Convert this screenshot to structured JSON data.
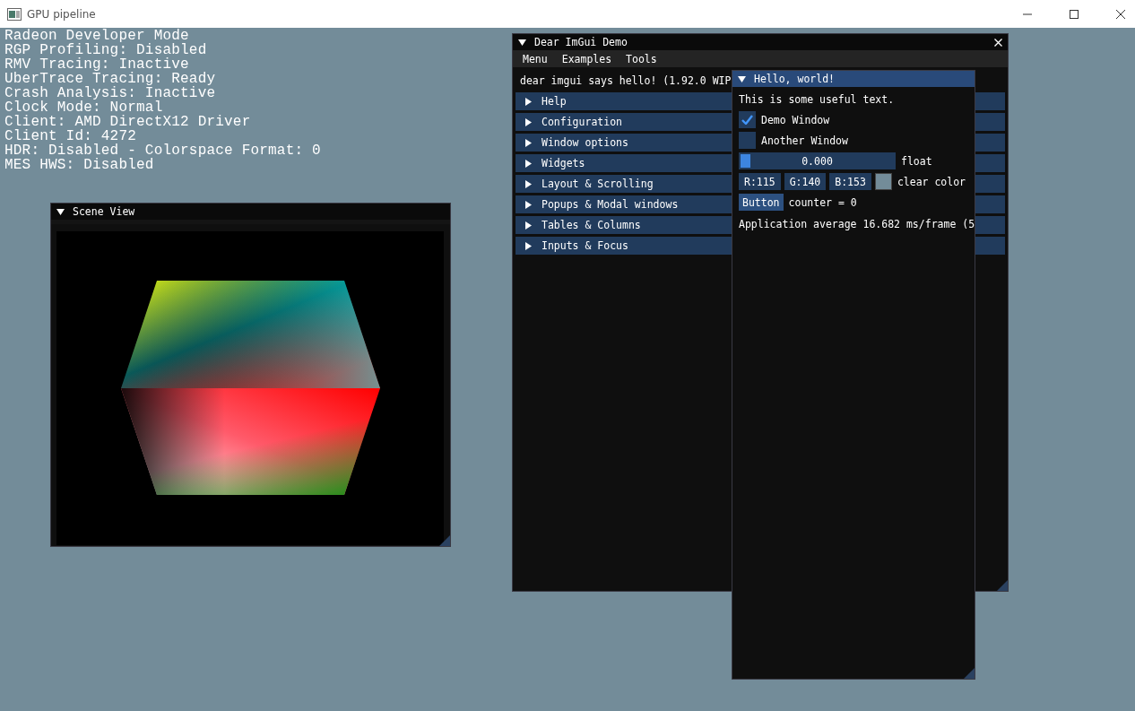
{
  "window": {
    "title": "GPU pipeline"
  },
  "overlay_lines": [
    "Radeon Developer Mode",
    "RGP Profiling: Disabled",
    "RMV Tracing: Inactive",
    "UberTrace Tracing: Ready",
    "Crash Analysis: Inactive",
    "Clock Mode: Normal",
    "Client: AMD DirectX12 Driver",
    "Client Id: 4272",
    "HDR: Disabled - Colorspace Format: 0",
    "MES HWS: Disabled"
  ],
  "scene_view": {
    "title": "Scene View"
  },
  "demo_window": {
    "title": "Dear ImGui Demo",
    "menu": [
      "Menu",
      "Examples",
      "Tools"
    ],
    "greeting": "dear imgui says hello! (1.92.0 WIP",
    "headers": [
      {
        "label": "Help",
        "expanded": false
      },
      {
        "label": "Configuration",
        "expanded": false
      },
      {
        "label": "Window options",
        "expanded": false
      },
      {
        "label": "Widgets",
        "expanded": false
      },
      {
        "label": "Layout & Scrolling",
        "expanded": false
      },
      {
        "label": "Popups & Modal windows",
        "expanded": false
      },
      {
        "label": "Tables & Columns",
        "expanded": false
      },
      {
        "label": "Inputs & Focus",
        "expanded": false
      }
    ]
  },
  "hello_window": {
    "title": "Hello, world!",
    "text": "This is some useful text.",
    "checkboxes": [
      {
        "label": "Demo Window",
        "checked": true
      },
      {
        "label": "Another Window",
        "checked": false
      }
    ],
    "slider": {
      "value": "0.000",
      "level": 0,
      "label": "float"
    },
    "color": {
      "channels": [
        "R:115",
        "G:140",
        "B:153"
      ],
      "color": "#738c99",
      "label": "clear color"
    },
    "button": {
      "label": "Button",
      "counter": "counter = 0"
    },
    "stats": "Application average 16.682 ms/frame (5"
  }
}
